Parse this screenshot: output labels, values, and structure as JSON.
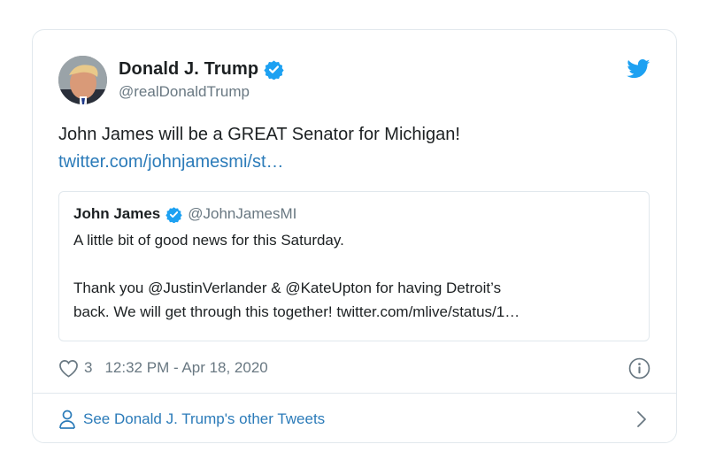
{
  "tweet": {
    "author_name": "Donald J. Trump",
    "author_handle": "@realDonaldTrump",
    "text": "John James will be a GREAT Senator for Michigan!",
    "link": "twitter.com/johnjamesmi/st…",
    "likes": "3",
    "timestamp": "12:32 PM - Apr 18, 2020"
  },
  "quote": {
    "author_name": "John James",
    "author_handle": "@JohnJamesMI",
    "line1": "A little bit of good news for this Saturday.",
    "line2": "Thank you @JustinVerlander & @KateUpton for having Detroit’s",
    "line3": "back. We will get through this together! twitter.com/mlive/status/1…"
  },
  "footer": {
    "label": "See Donald J. Trump's other Tweets"
  },
  "icons": {
    "brand": "twitter-bird-icon",
    "verified": "verified-badge-icon",
    "like": "heart-icon",
    "info": "info-icon",
    "profile": "person-icon",
    "chevron": "chevron-right-icon"
  },
  "colors": {
    "link": "#2b7bb9",
    "verified": "#1da1f2",
    "text": "#1c2022",
    "muted": "#697882",
    "border": "#e1e8ed"
  }
}
